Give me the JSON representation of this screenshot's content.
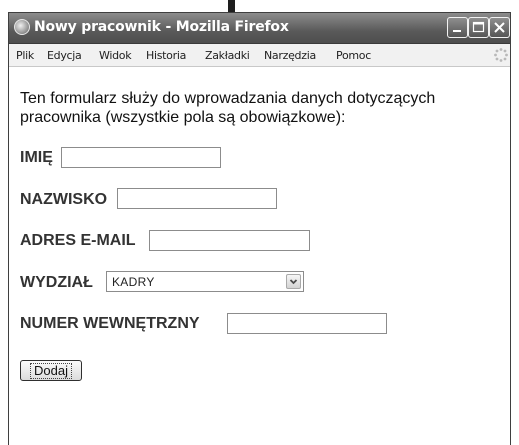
{
  "window": {
    "title": "Nowy pracownik - Mozilla Firefox",
    "icon": "firefox-icon",
    "controls": [
      "minimize-icon",
      "maximize-icon",
      "close-icon"
    ]
  },
  "menubar": {
    "items": [
      "Plik",
      "Edycja",
      "Widok",
      "Historia",
      "Zakładki",
      "Narzędzia",
      "Pomoc"
    ]
  },
  "form": {
    "intro": "Ten formularz służy do wprowadzania danych dotyczących pracownika (wszystkie pola są obowiązkowe):",
    "first_name_label": "IMIĘ",
    "first_name_value": "",
    "last_name_label": "NAZWISKO",
    "last_name_value": "",
    "email_label": "ADRES E-MAIL",
    "email_value": "",
    "department_label": "WYDZIAŁ",
    "department_selected": "KADRY",
    "extension_label": "NUMER WEWNĘTRZNY",
    "extension_value": "",
    "submit_label": "Dodaj"
  }
}
